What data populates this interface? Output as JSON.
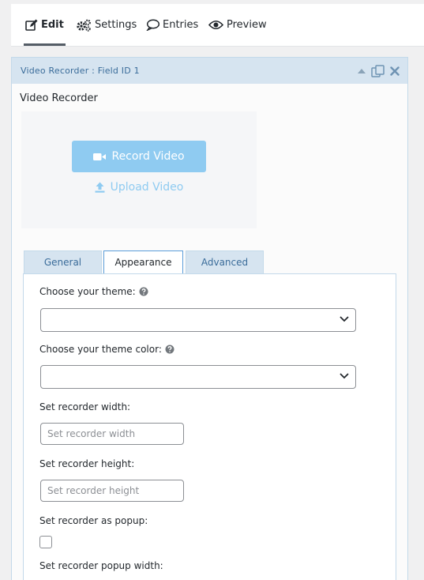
{
  "top_tabs": [
    {
      "label": "Edit",
      "icon": "edit-icon",
      "active": true
    },
    {
      "label": "Settings",
      "icon": "gears-icon",
      "active": false
    },
    {
      "label": "Entries",
      "icon": "speech-bubble-icon",
      "active": false
    },
    {
      "label": "Preview",
      "icon": "eye-icon",
      "active": false
    }
  ],
  "panel": {
    "header_title": "Video Recorder : Field ID 1",
    "header_icons": [
      "collapse-arrow-icon",
      "duplicate-icon",
      "close-icon"
    ],
    "field_label": "Video Recorder",
    "record_button": "Record Video",
    "record_icon": "video-camera-icon",
    "upload_link": "Upload Video",
    "upload_icon": "upload-icon"
  },
  "settings_tabs": [
    {
      "label": "General",
      "active": false
    },
    {
      "label": "Appearance",
      "active": true
    },
    {
      "label": "Advanced",
      "active": false
    }
  ],
  "appearance": {
    "theme_label": "Choose your theme:",
    "theme_value": "",
    "theme_color_label": "Choose your theme color:",
    "theme_color_value": "",
    "width_label": "Set recorder width:",
    "width_placeholder": "Set recorder width",
    "height_label": "Set recorder height:",
    "height_placeholder": "Set recorder height",
    "popup_label": "Set recorder as popup:",
    "popup_checked": false,
    "popup_width_label": "Set recorder popup width:"
  },
  "colors": {
    "accent_blue": "#8fcbf1",
    "header_blue": "#d6e4f0",
    "header_text": "#3a6c9a",
    "active_tab_border": "#5b9dd9"
  }
}
